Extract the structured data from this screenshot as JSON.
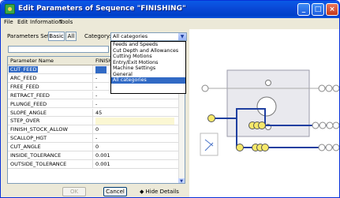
{
  "window": {
    "title": "Edit Parameters of Sequence \"FINISHING\"",
    "min": "_",
    "max": "□",
    "close": "×"
  },
  "menu": [
    "File",
    "Edit",
    "Information",
    "Tools"
  ],
  "toolbar": {
    "params_set_label": "Parameters Set:",
    "basic_label": "Basic",
    "all_label": "All",
    "category_label": "Category:",
    "category_value": "All categories"
  },
  "dropdown_options": [
    "Feeds and Speeds",
    "Cut Depth and Allowances",
    "Cutting Motions",
    "Entry/Exit Motions",
    "Machine Settings",
    "General",
    "All categories"
  ],
  "dropdown_selected_index": 6,
  "grid": {
    "col_name": "Parameter Name",
    "col_value": "FINISH",
    "rows": [
      {
        "name": "CUT_FEED",
        "value": ""
      },
      {
        "name": "ARC_FEED",
        "value": "-"
      },
      {
        "name": "FREE_FEED",
        "value": "-"
      },
      {
        "name": "RETRACT_FEED",
        "value": "-"
      },
      {
        "name": "PLUNGE_FEED",
        "value": "-"
      },
      {
        "name": "SLOPE_ANGLE",
        "value": "45"
      },
      {
        "name": "STEP_OVER",
        "value": ""
      },
      {
        "name": "FINISH_STOCK_ALLOW",
        "value": "0"
      },
      {
        "name": "SCALLOP_HGT",
        "value": "-"
      },
      {
        "name": "CUT_ANGLE",
        "value": "0"
      },
      {
        "name": "INSIDE_TOLERANCE",
        "value": "0.001"
      },
      {
        "name": "OUTSIDE_TOLERANCE",
        "value": "0.001"
      }
    ]
  },
  "footer": {
    "ok": "OK",
    "cancel": "Cancel",
    "hide_details": "Hide Details"
  },
  "colors": {
    "title_blue": "#0a49d8",
    "selection": "#316ac5",
    "highlight_yellow": "#f5e86a",
    "diagram_line": "#1f3fa0"
  }
}
